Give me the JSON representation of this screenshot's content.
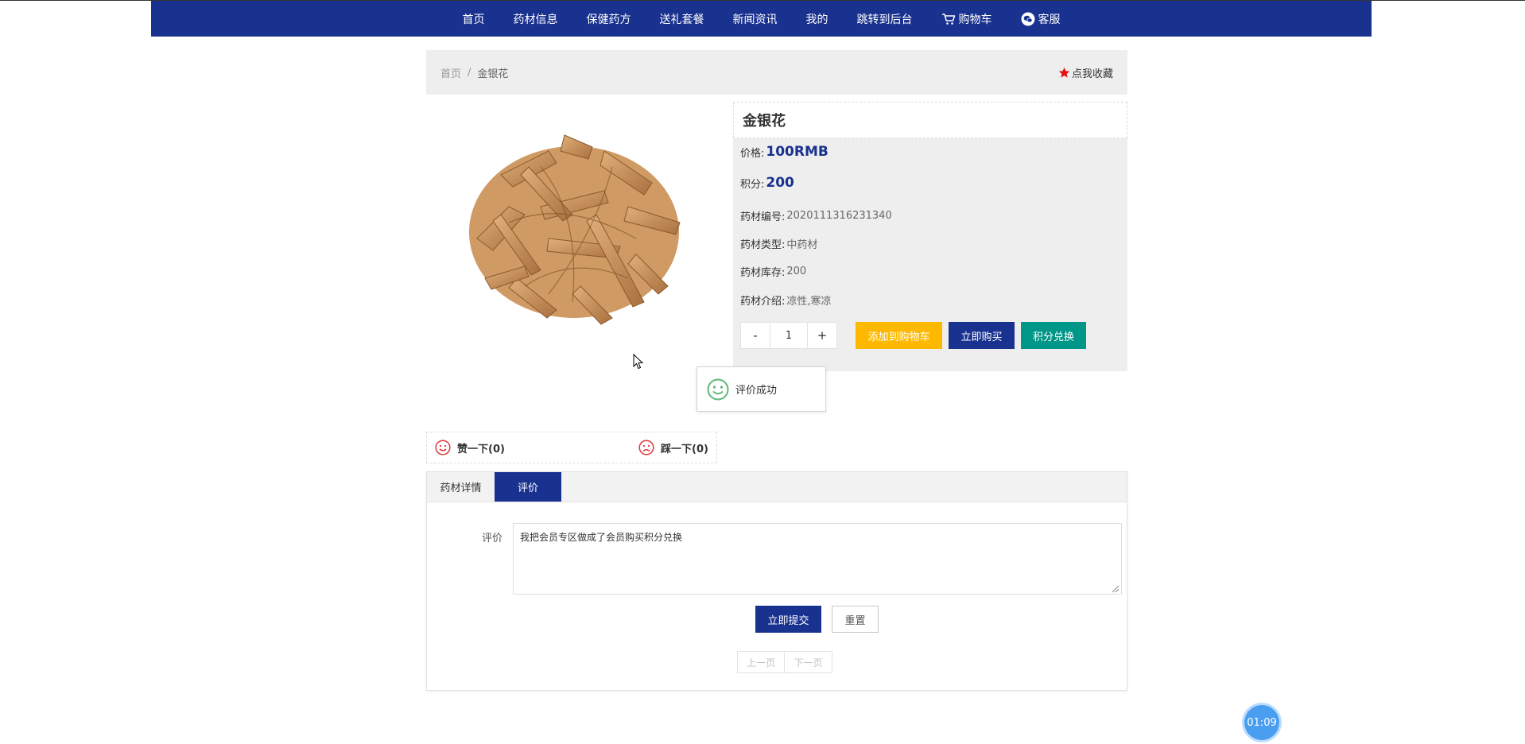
{
  "nav": {
    "items": [
      "首页",
      "药材信息",
      "保健药方",
      "送礼套餐",
      "新闻资讯",
      "我的",
      "跳转到后台"
    ],
    "cart_label": "购物车",
    "service_label": "客服"
  },
  "breadcrumb": {
    "home": "首页",
    "separator": "/",
    "current": "金银花"
  },
  "favorite_label": "点我收藏",
  "product": {
    "name": "金银花",
    "price_label": "价格:",
    "price": "100RMB",
    "points_label": "积分:",
    "points": "200",
    "code_label": "药材编号:",
    "code": "2020111316231340",
    "type_label": "药材类型:",
    "type": "中药材",
    "stock_label": "药材库存:",
    "stock": "200",
    "intro_label": "药材介绍:",
    "intro": "凉性,寒凉"
  },
  "quantity": {
    "minus": "-",
    "value": "1",
    "plus": "+"
  },
  "buttons": {
    "add_cart": "添加到购物车",
    "buy_now": "立即购买",
    "redeem": "积分兑换"
  },
  "colors": {
    "brand": "#19328f",
    "add_cart": "#ffb800",
    "redeem": "#009688",
    "toast_icon": "#5fb878",
    "like_icon": "#e0353a"
  },
  "toast": {
    "message": "评价成功"
  },
  "likes": {
    "like_label": "赞一下(0)",
    "dislike_label": "踩一下(0)"
  },
  "tabs": {
    "items": [
      "药材详情",
      "评价"
    ],
    "active": "评价"
  },
  "review_form": {
    "label": "评价",
    "content": "我把会员专区做成了会员购买积分兑换",
    "submit": "立即提交",
    "reset": "重置"
  },
  "pager": {
    "prev": "上一页",
    "next": "下一页"
  },
  "timer": {
    "value": "01:09"
  }
}
